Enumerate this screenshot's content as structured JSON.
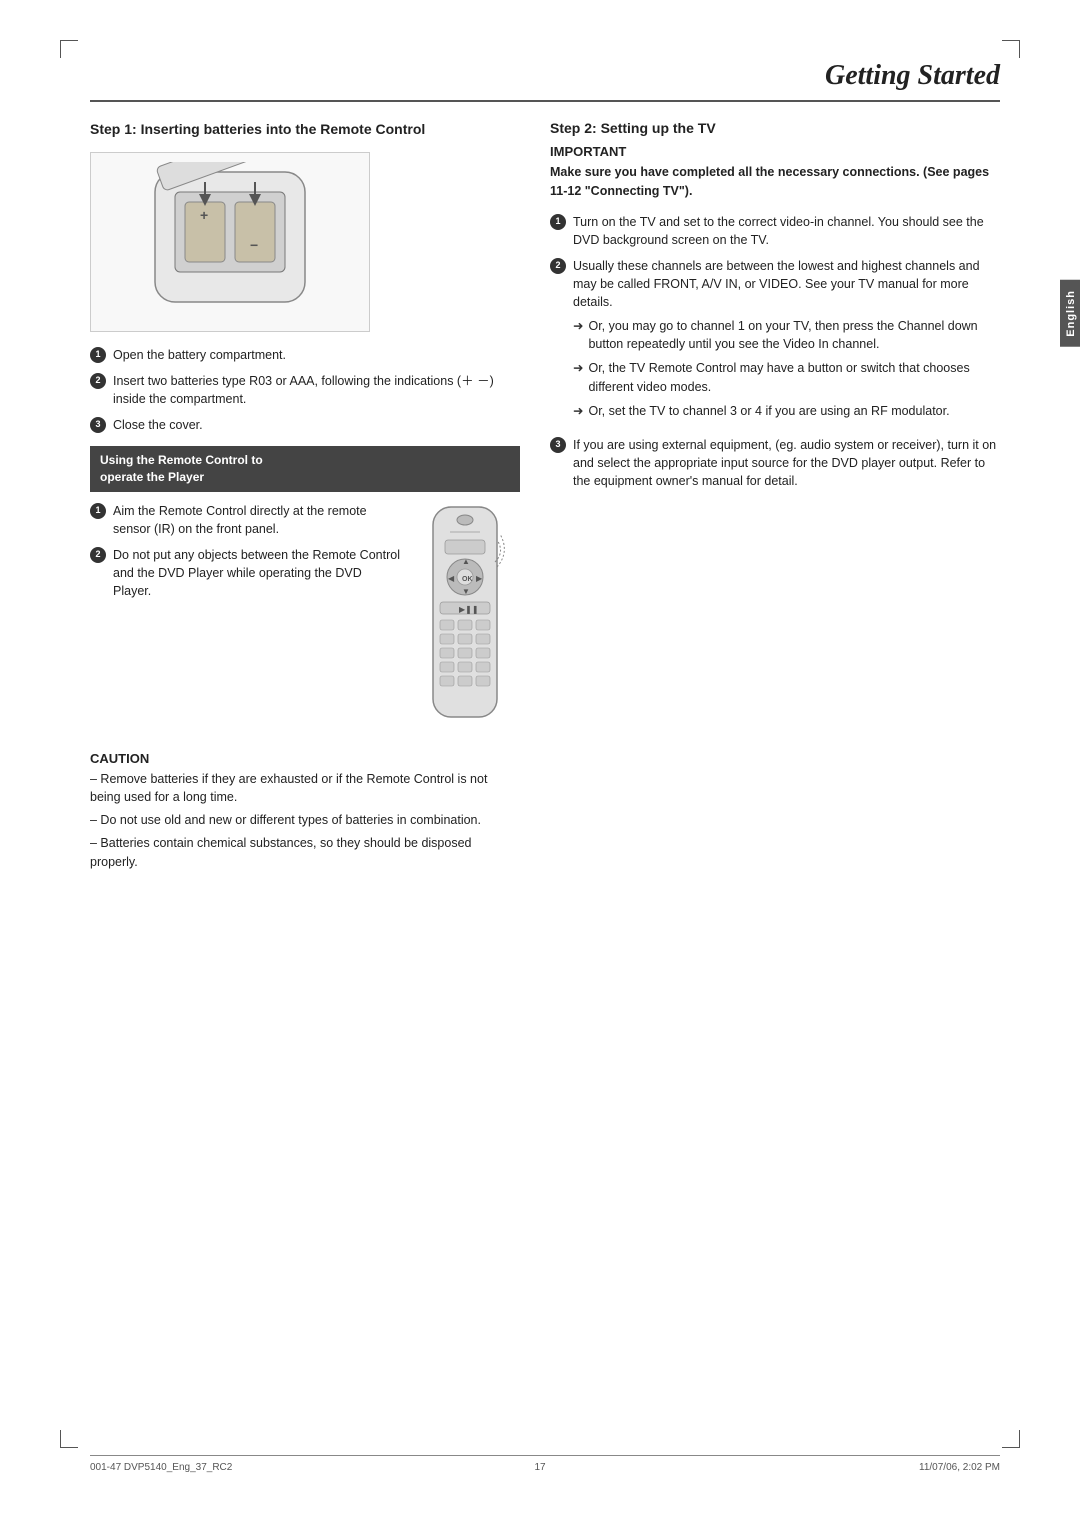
{
  "page": {
    "title": "Getting Started",
    "page_number": "17",
    "footer_left": "001-47 DVP5140_Eng_37_RC2",
    "footer_center": "17",
    "footer_right": "11/07/06, 2:02 PM",
    "english_tab": "English"
  },
  "left_column": {
    "step1_heading": "Step 1:  Inserting batteries into the Remote Control",
    "battery_steps": [
      "Open the battery compartment.",
      "Insert two batteries type R03 or AAA, following the indications (＋ －) inside the compartment.",
      "Close the cover."
    ],
    "using_box_line1": "Using the Remote Control to",
    "using_box_line2": "operate the Player",
    "remote_steps": [
      "Aim the Remote Control directly at the remote sensor (IR) on the front panel.",
      "Do not put any objects between the Remote Control and the DVD Player while operating the DVD Player."
    ],
    "caution_title": "CAUTION",
    "caution_items": [
      "–  Remove batteries if they are exhausted or if the Remote Control is not being used for a long time.",
      "–  Do not use old and new or different types of batteries in combination.",
      "–  Batteries contain chemical substances, so they should be disposed properly."
    ]
  },
  "right_column": {
    "step2_heading": "Step 2:   Setting up the TV",
    "important_label": "IMPORTANT",
    "important_text": "Make sure you have completed all the necessary connections. (See pages 11-12 \"Connecting TV\").",
    "main_steps": [
      "Turn on the TV and set to the correct video-in channel. You should see the DVD background screen on the TV.",
      "Usually these channels are between the lowest and highest channels and may be called FRONT, A/V IN, or VIDEO. See your TV manual for more details."
    ],
    "arrow_items": [
      "Or, you may go to channel 1 on your TV, then press the Channel down button repeatedly until you see the Video In channel.",
      "Or, the TV Remote Control may have a button or switch that chooses different video modes.",
      "Or, set the TV to channel 3 or 4 if you are using an RF modulator."
    ],
    "step3_text": "If you are using external equipment, (eg. audio system or receiver), turn it on and select the appropriate input source for the DVD player output. Refer to the equipment owner's manual for detail."
  }
}
